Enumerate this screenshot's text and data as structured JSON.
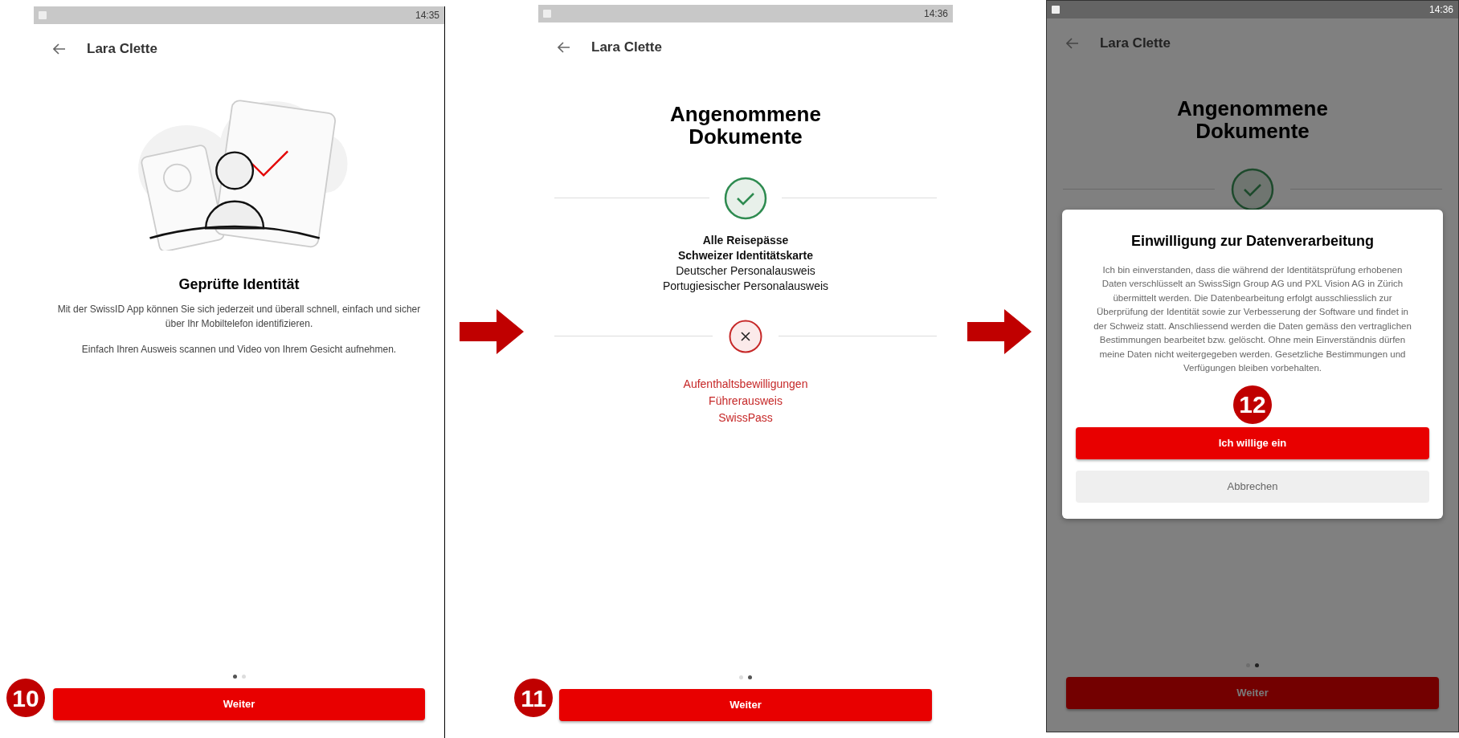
{
  "screens": [
    {
      "kind": "intro",
      "status_time": "14:35",
      "header_title": "Lara Clette",
      "title": "Geprüfte Identität",
      "paragraphs": [
        "Mit der SwissID App können Sie sich jederzeit und überall schnell, einfach und sicher über Ihr Mobiltelefon identifizieren.",
        "Einfach Ihren Ausweis scannen und Video von Ihrem Gesicht aufnehmen."
      ],
      "page_dots": [
        {
          "selected": true
        },
        {
          "selected": false
        }
      ],
      "button": "Weiter",
      "step_badge": "10"
    },
    {
      "kind": "documents",
      "status_time": "14:36",
      "header_title": "Lara Clette",
      "title": "Angenommene Dokumente",
      "accepted": [
        {
          "label": "Alle Reisepässe",
          "bold": true
        },
        {
          "label": "Schweizer Identitätskarte",
          "bold": true
        },
        {
          "label": "Deutscher Personalausweis",
          "bold": false
        },
        {
          "label": "Portugiesischer Personalausweis",
          "bold": false
        }
      ],
      "rejected": [
        "Aufenthaltsbewilligungen",
        "Führerausweis",
        "SwissPass"
      ],
      "page_dots": [
        {
          "selected": false
        },
        {
          "selected": true
        }
      ],
      "button": "Weiter",
      "step_badge": "11"
    },
    {
      "kind": "consent",
      "status_time": "14:36",
      "header_title": "Lara Clette",
      "title": "Angenommene Dokumente",
      "dialog": {
        "title": "Einwilligung zur Datenverarbeitung",
        "text": "Ich bin einverstanden, dass die während der Identitätsprüfung erhobenen Daten verschlüsselt an SwissSign Group AG und PXL Vision AG in Zürich übermittelt werden. Die Datenbearbeitung erfolgt ausschliesslich zur Überprüfung der Identität sowie zur Verbesserung der Software und findet in der Schweiz statt. Anschliessend werden die Daten gemäss den vertraglichen Bestimmungen bearbeitet bzw. gelöscht. Ohne mein Einverständnis dürfen meine Daten nicht weitergegeben werden. Gesetzliche Bestimmungen und Verfügungen bleiben vorbehalten.",
        "confirm_button": "Ich willige ein",
        "cancel_button": "Abbrechen",
        "step_badge": "12"
      },
      "page_dots": [
        {
          "selected": false
        },
        {
          "selected": true
        }
      ],
      "button": "Weiter"
    }
  ]
}
